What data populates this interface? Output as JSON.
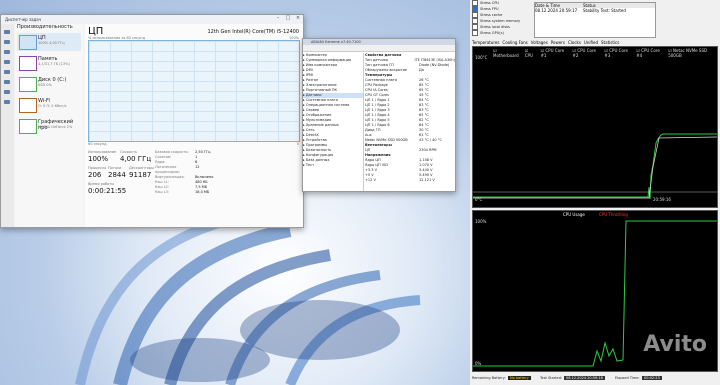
{
  "taskmanager": {
    "title": "Диспетчер задач",
    "section": "Производительность",
    "items": [
      {
        "name": "ЦП",
        "sub": "100% 4,00 ГГц"
      },
      {
        "name": "Память",
        "sub": "4,1/31,7 ГБ (13%)"
      },
      {
        "name": "Диск 0 (C:)",
        "sub": "SSD 0%"
      },
      {
        "name": "Wi-Fi",
        "sub": "О: 0 П: 0 Кбит/с"
      },
      {
        "name": "Графический про",
        "sub": "NVIDIA GeForce 2%"
      }
    ],
    "header": "ЦП",
    "cpu_model": "12th Gen Intel(R) Core(TM) i5-12400",
    "graph_label": "% использования за 60 секунд",
    "graph_max": "100%",
    "graph_bottom_left": "60 секунд",
    "graph_bottom_right": "0",
    "stats": {
      "util_label": "Использование",
      "util": "100%",
      "speed_label": "Скорость",
      "speed": "4,00 ГГц",
      "proc_label": "Процессы",
      "proc": "206",
      "threads_label": "Потоки",
      "threads": "2844",
      "handles_label": "Дескрипторы",
      "handles": "91187",
      "uptime_label": "Время работы",
      "uptime": "0:00:21:55"
    },
    "details": [
      [
        "Базовая скорость:",
        "2,50 ГГц"
      ],
      [
        "Сокетов:",
        "1"
      ],
      [
        "Ядра:",
        "6"
      ],
      [
        "Логических процессоров:",
        "12"
      ],
      [
        "Виртуализация:",
        "Включено"
      ],
      [
        "Кэш L1:",
        "480 КБ"
      ],
      [
        "Кэш L2:",
        "7,5 МБ"
      ],
      [
        "Кэш L3:",
        "18,0 МБ"
      ]
    ]
  },
  "aida": {
    "title": "AIDA64 Extreme v7.40.7100",
    "tree": [
      "Компьютер",
      "Суммарная информация",
      "Имя компьютера",
      "DMI",
      "IPMI",
      "Разгон",
      "Электропитание",
      "Портативный ПК",
      "Датчики",
      "Системная плата",
      "Операционная система",
      "Сервер",
      "Отображение",
      "Мультимедиа",
      "Хранение данных",
      "Сеть",
      "DirectX",
      "Устройства",
      "Программы",
      "Безопасность",
      "Конфигурация",
      "База данных",
      "Тест"
    ],
    "rows": [
      [
        "Свойства датчика",
        ""
      ],
      [
        "Тип датчика",
        "ITE IT8613E (ISA A30h)"
      ],
      [
        "Тип датчика ГП",
        "Diode (NV-Diode)"
      ],
      [
        "Обнаружено вскрытие",
        "Да"
      ],
      [
        "Температуры",
        ""
      ],
      [
        "Системная плата",
        "26 °C"
      ],
      [
        "CPU Package",
        "65 °C"
      ],
      [
        "CPU IA Cores",
        "65 °C"
      ],
      [
        "CPU GT Cores",
        "45 °C"
      ],
      [
        "ЦП 1 / Ядро 1",
        "64 °C"
      ],
      [
        "ЦП 1 / Ядро 2",
        "63 °C"
      ],
      [
        "ЦП 1 / Ядро 3",
        "63 °C"
      ],
      [
        "ЦП 1 / Ядро 4",
        "65 °C"
      ],
      [
        "ЦП 1 / Ядро 5",
        "62 °C"
      ],
      [
        "ЦП 1 / Ядро 6",
        "64 °C"
      ],
      [
        "Диод ГП",
        "30 °C"
      ],
      [
        "Aux",
        "61 °C"
      ],
      [
        "Netac NVMe SSD 500GB",
        "43 °C / 40 °C"
      ],
      [
        "Вентиляторы",
        ""
      ],
      [
        "ЦП",
        "2304 RPM"
      ],
      [
        "Напряжения",
        ""
      ],
      [
        "Ядро ЦП",
        "1.108 V"
      ],
      [
        "Ядро ЦП VID",
        "1.070 V"
      ],
      [
        "+3.3 V",
        "3.440 V"
      ],
      [
        "+5 V",
        "5.490 V"
      ],
      [
        "+12 V",
        "12.121 V"
      ]
    ]
  },
  "stability": {
    "checks": [
      {
        "label": "Stress CPU",
        "checked": false
      },
      {
        "label": "Stress FPU",
        "checked": true
      },
      {
        "label": "Stress cache",
        "checked": false
      },
      {
        "label": "Stress system memory",
        "checked": false
      },
      {
        "label": "Stress local disks",
        "checked": false
      },
      {
        "label": "Stress GPU(s)",
        "checked": false
      }
    ],
    "info_header_left": "Date & Time",
    "info_header_right": "Status",
    "date": "08.12.2024 20:59:17",
    "status": "Stability Test: Started",
    "tabs": [
      "Temperatures",
      "Cooling Fans",
      "Voltages",
      "Powers",
      "Clocks",
      "Unified",
      "Statistics"
    ],
    "legend": [
      "Motherboard",
      "CPU",
      "CPU Core #1",
      "CPU Core #2",
      "CPU Core #3",
      "CPU Core #4",
      "Netac NVMe SSD 500GB"
    ],
    "temp_top": "100°C",
    "temp_bottom": "0°C",
    "time_label": "20:59:16",
    "cpu_title": "CPU Usage",
    "throttle_title": "CPU Throttling",
    "usage_top": "100%",
    "usage_bottom": "0%",
    "battery_label": "Remaining Battery:",
    "battery": "No battery",
    "test_started_label": "Test Started:",
    "test_started": "08.12.2024 20:59:16",
    "elapsed_label": "Elapsed Time:",
    "elapsed": "00:02:23"
  },
  "watermark": "Avito",
  "colors": {
    "accent": "#0078d4",
    "cpu_graph": "#117dbb",
    "aida_bg": "#ffffff"
  }
}
